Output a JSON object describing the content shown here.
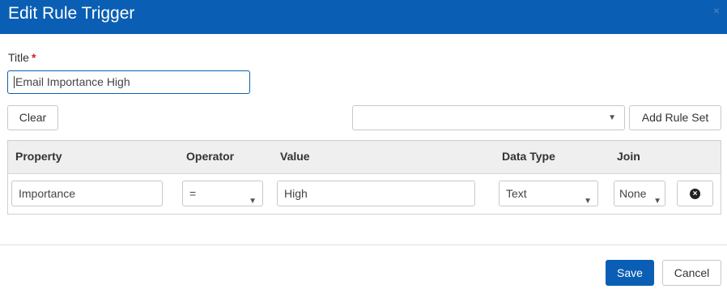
{
  "dialog": {
    "title": "Edit Rule Trigger",
    "close_glyph": "×"
  },
  "form": {
    "title_label": "Title",
    "required_marker": "*",
    "title_value": "Email Importance High"
  },
  "toolbar": {
    "clear_label": "Clear",
    "ruleset_selected": "",
    "add_ruleset_label": "Add Rule Set"
  },
  "grid": {
    "columns": [
      "Property",
      "Operator",
      "Value",
      "Data Type",
      "Join"
    ],
    "rows": [
      {
        "property": "Importance",
        "operator": "=",
        "value": "High",
        "data_type": "Text",
        "join": "None"
      }
    ]
  },
  "footer": {
    "save_label": "Save",
    "cancel_label": "Cancel"
  },
  "icons": {
    "dropdown": "chevron-down-icon",
    "delete": "remove-circle-icon",
    "close": "close-icon"
  },
  "colors": {
    "header_bg": "#0a5fb4",
    "primary_button": "#0a5fb4",
    "required": "#d01f1f"
  }
}
